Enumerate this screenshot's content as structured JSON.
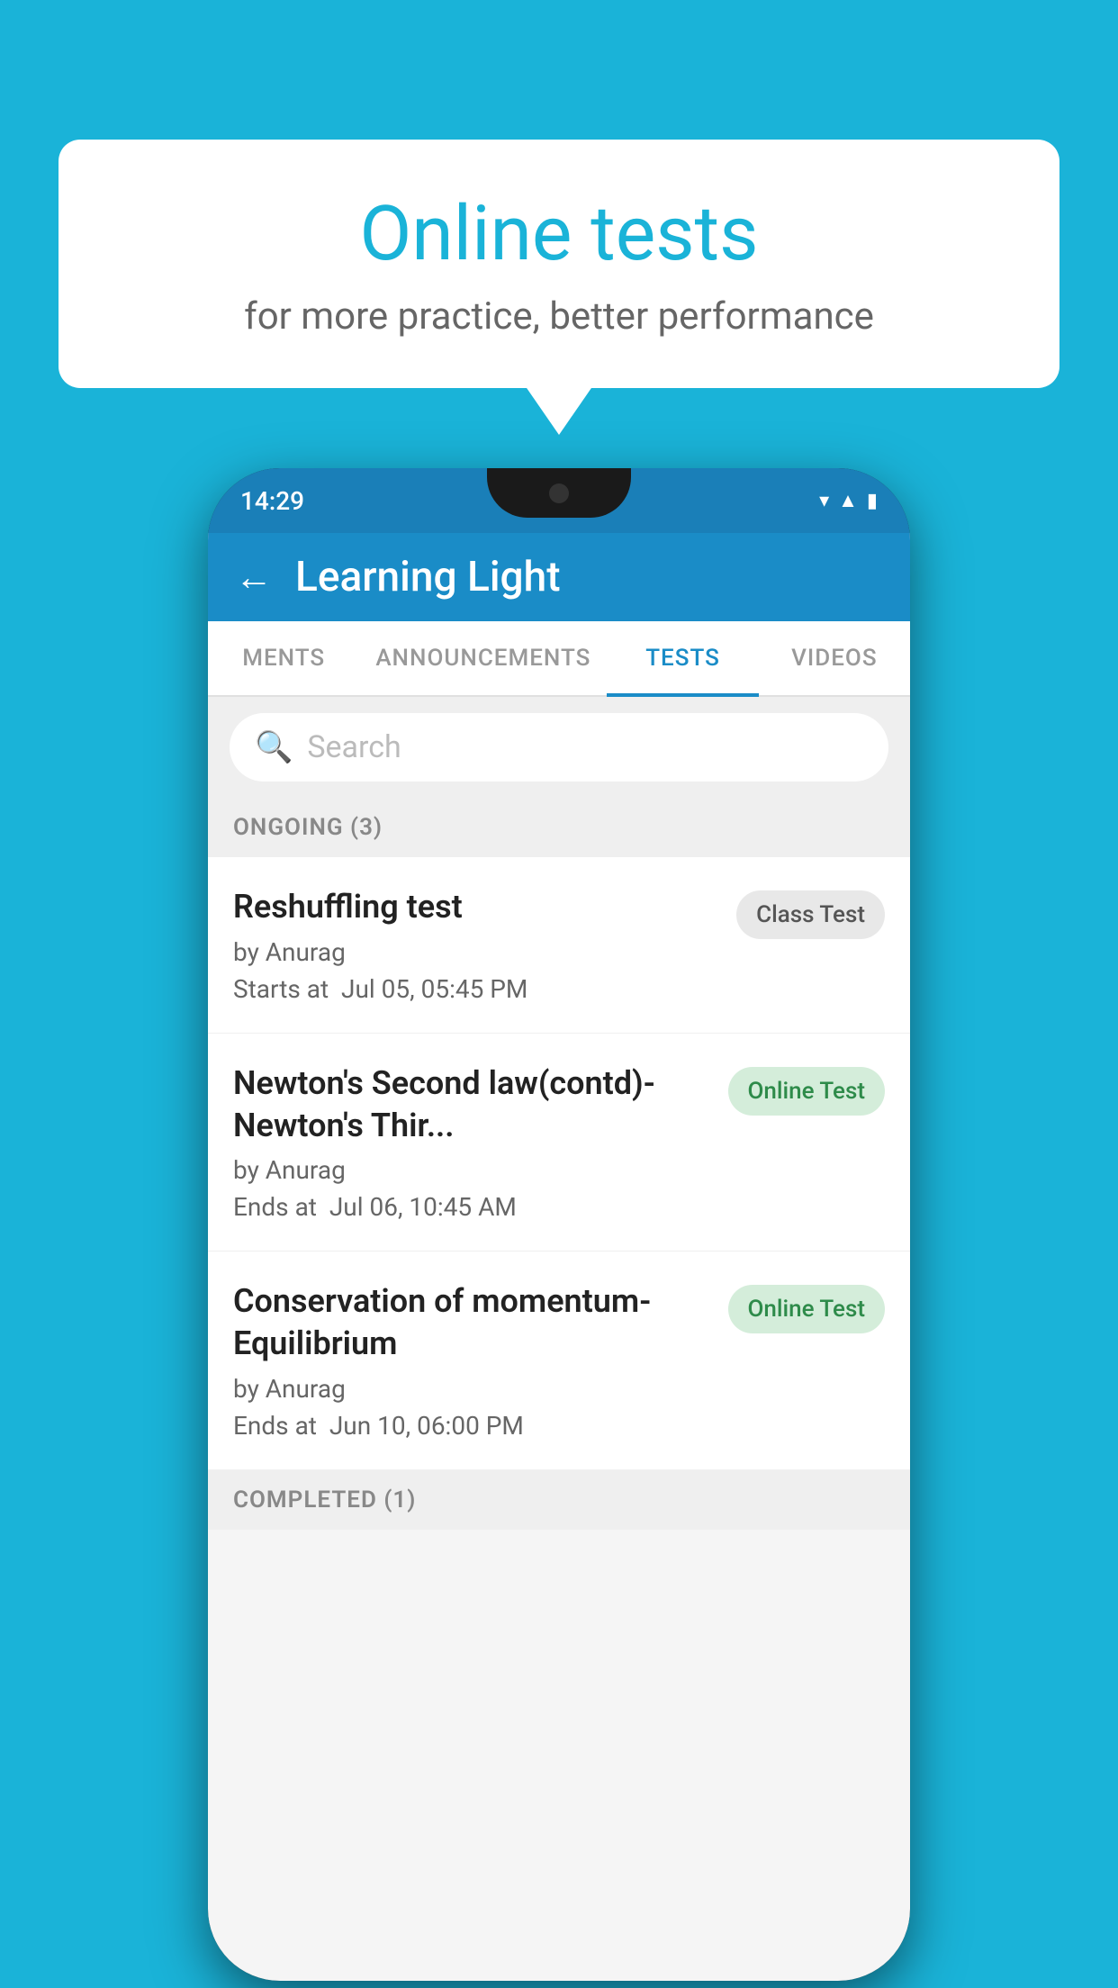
{
  "background": {
    "color": "#1ab3d8"
  },
  "speech_bubble": {
    "title": "Online tests",
    "subtitle": "for more practice, better performance"
  },
  "phone": {
    "status_bar": {
      "time": "14:29",
      "icons": [
        "wifi",
        "signal",
        "battery"
      ]
    },
    "header": {
      "back_label": "←",
      "title": "Learning Light"
    },
    "tabs": [
      {
        "label": "MENTS",
        "active": false
      },
      {
        "label": "ANNOUNCEMENTS",
        "active": false
      },
      {
        "label": "TESTS",
        "active": true
      },
      {
        "label": "VIDEOS",
        "active": false
      }
    ],
    "search": {
      "placeholder": "Search"
    },
    "sections": [
      {
        "header": "ONGOING (3)",
        "items": [
          {
            "title": "Reshuffling test",
            "author": "by Anurag",
            "time_label": "Starts at",
            "time_value": "Jul 05, 05:45 PM",
            "badge": "Class Test",
            "badge_type": "class"
          },
          {
            "title": "Newton's Second law(contd)-Newton's Thir...",
            "author": "by Anurag",
            "time_label": "Ends at",
            "time_value": "Jul 06, 10:45 AM",
            "badge": "Online Test",
            "badge_type": "online"
          },
          {
            "title": "Conservation of momentum-Equilibrium",
            "author": "by Anurag",
            "time_label": "Ends at",
            "time_value": "Jun 10, 06:00 PM",
            "badge": "Online Test",
            "badge_type": "online"
          }
        ]
      }
    ],
    "completed_header": "COMPLETED (1)"
  }
}
